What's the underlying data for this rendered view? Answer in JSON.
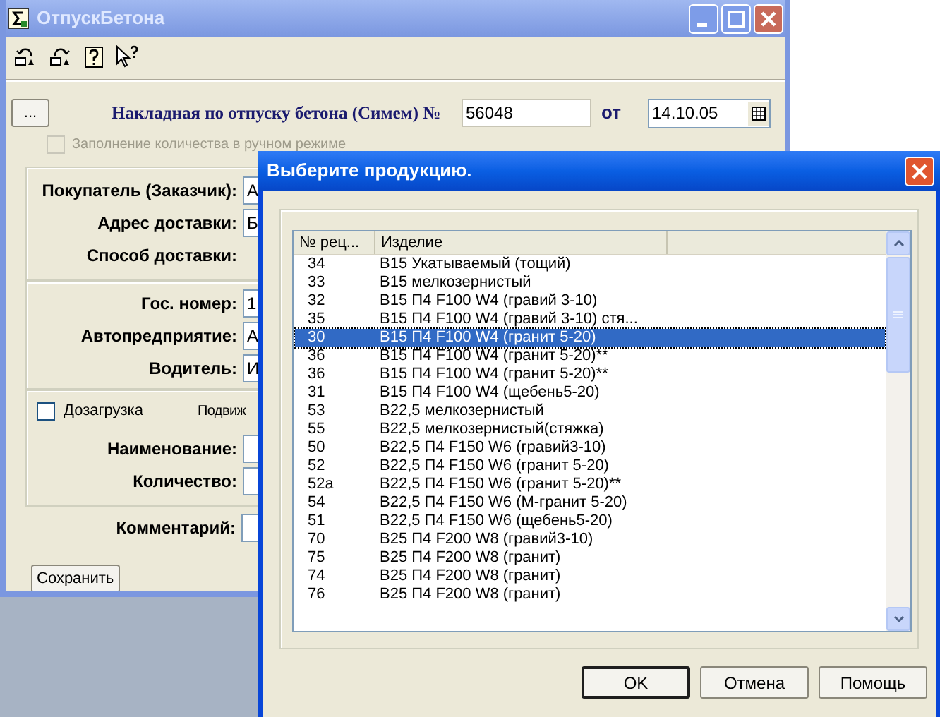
{
  "main_window": {
    "title": "ОтпускБетона",
    "header": {
      "more_button": "...",
      "label": "Накладная по отпуску бетона (Симем) №",
      "number": "56048",
      "date_label": "от",
      "date": "14.10.05"
    },
    "manual_fill": {
      "label": "Заполнение количества в ручном режиме",
      "checked": false,
      "disabled": true
    },
    "groups": [
      {
        "rows": [
          {
            "kind": "input",
            "label": "Покупатель (Заказчик):",
            "value": "А"
          },
          {
            "kind": "input",
            "label": "Адрес доставки:",
            "value": "Б"
          },
          {
            "kind": "static",
            "label": "Способ доставки:"
          }
        ]
      },
      {
        "rows": [
          {
            "kind": "input",
            "label": "Гос. номер:",
            "value": "1"
          },
          {
            "kind": "input",
            "label": "Автопредприятие:",
            "value": "А"
          },
          {
            "kind": "input",
            "label": "Водитель:",
            "value": "И"
          }
        ]
      },
      {
        "reload": {
          "label": "Дозагрузка",
          "checked": false
        },
        "note": "Подвиж",
        "rows": [
          {
            "kind": "input",
            "label": "Наименование:"
          },
          {
            "kind": "input",
            "label": "Количество:"
          }
        ]
      }
    ],
    "comment_label": "Комментарий:",
    "save_button": "Сохранить"
  },
  "dialog": {
    "title": "Выберите продукцию.",
    "columns": [
      "№ рец...",
      "Изделие"
    ],
    "rows": [
      {
        "number": "34",
        "product": "В15  Укатываемый (тощий)",
        "selected": false
      },
      {
        "number": "33",
        "product": "В15 мелкозернистый",
        "selected": false
      },
      {
        "number": "32",
        "product": "В15 П4 F100 W4 (гравий  3-10)",
        "selected": false
      },
      {
        "number": "35",
        "product": "В15 П4 F100 W4 (гравий  3-10) стя...",
        "selected": false
      },
      {
        "number": "30",
        "product": "В15 П4 F100 W4 (гранит 5-20)",
        "selected": true
      },
      {
        "number": "36",
        "product": "В15 П4 F100 W4 (гранит 5-20)**",
        "selected": false
      },
      {
        "number": "36",
        "product": "В15 П4 F100 W4 (гранит 5-20)**",
        "selected": false
      },
      {
        "number": "31",
        "product": "В15 П4 F100 W4 (щебень5-20)",
        "selected": false
      },
      {
        "number": "53",
        "product": "В22,5 мелкозернистый",
        "selected": false
      },
      {
        "number": "55",
        "product": "В22,5 мелкозернистый(стяжка)",
        "selected": false
      },
      {
        "number": "50",
        "product": "В22,5 П4 F150 W6 (гравий3-10)",
        "selected": false
      },
      {
        "number": "52",
        "product": "В22,5 П4 F150 W6 (гранит 5-20)",
        "selected": false
      },
      {
        "number": "52а",
        "product": "В22,5 П4 F150 W6 (гранит 5-20)**",
        "selected": false
      },
      {
        "number": "54",
        "product": "В22,5 П4 F150 W6 (М-гранит 5-20)",
        "selected": false
      },
      {
        "number": "51",
        "product": "В22,5 П4 F150 W6 (щебень5-20)",
        "selected": false
      },
      {
        "number": "70",
        "product": "В25 П4 F200 W8 (гравий3-10)",
        "selected": false
      },
      {
        "number": "75",
        "product": "В25 П4 F200 W8 (гранит)",
        "selected": false
      },
      {
        "number": "74",
        "product": "В25 П4 F200 W8 (гранит)",
        "selected": false
      },
      {
        "number": "76",
        "product": "В25 П4 F200 W8 (гранит)",
        "selected": false
      }
    ],
    "buttons": [
      {
        "label": "OK",
        "default": true
      },
      {
        "label": "Отмена",
        "default": false
      },
      {
        "label": "Помощь",
        "default": false
      }
    ]
  }
}
